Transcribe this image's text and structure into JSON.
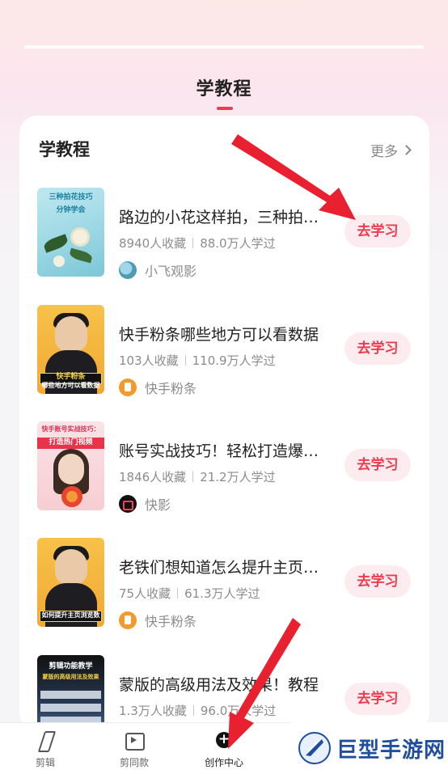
{
  "header": {
    "tab_title": "学教程"
  },
  "tutorial_section": {
    "title": "学教程",
    "more_label": "更多"
  },
  "items": [
    {
      "thumb_caption": "三种拍花技巧",
      "thumb_caption_2": "分钟学会",
      "title": "路边的小花这样拍，三种拍摄技巧",
      "favorites": "8940人收藏",
      "learners": "88.0万人学过",
      "author": "小飞观影",
      "button": "去学习"
    },
    {
      "thumb_caption": "快手粉条",
      "thumb_caption_2": "哪些地方可以看数据",
      "title": "快手粉条哪些地方可以看数据",
      "favorites": "103人收藏",
      "learners": "110.9万人学过",
      "author": "快手粉条",
      "button": "去学习"
    },
    {
      "thumb_caption": "快手账号实战技巧：",
      "thumb_caption_2": "打造热门视频",
      "title": "账号实战技巧！轻松打造爆款视频",
      "favorites": "1846人收藏",
      "learners": "21.2万人学过",
      "author": "快影",
      "button": "去学习"
    },
    {
      "thumb_caption": "如何提升主页浏览数",
      "title": "老铁们想知道怎么提升主页浏览数",
      "favorites": "75人收藏",
      "learners": "61.3万人学过",
      "author": "快手粉条",
      "button": "去学习"
    },
    {
      "thumb_caption": "剪辑功能教学",
      "thumb_caption_2": "蒙版的高级用法及效果",
      "title": "蒙版的高级用法及效果！教程",
      "favorites": "1.3万人收藏",
      "learners": "96.0万人学过",
      "button": "去学习"
    }
  ],
  "tabbar": {
    "tabs": [
      {
        "label": "剪辑",
        "icon": "lightning-icon"
      },
      {
        "label": "剪同款",
        "icon": "play-frame-icon"
      },
      {
        "label": "创作中心",
        "icon": "create-plus-icon"
      }
    ]
  },
  "watermark": {
    "text": "巨型手游网"
  },
  "colors": {
    "accent": "#ef3b4e",
    "button_bg": "#fdecef",
    "arrow": "#e8202f",
    "watermark": "#1f4e9e"
  }
}
